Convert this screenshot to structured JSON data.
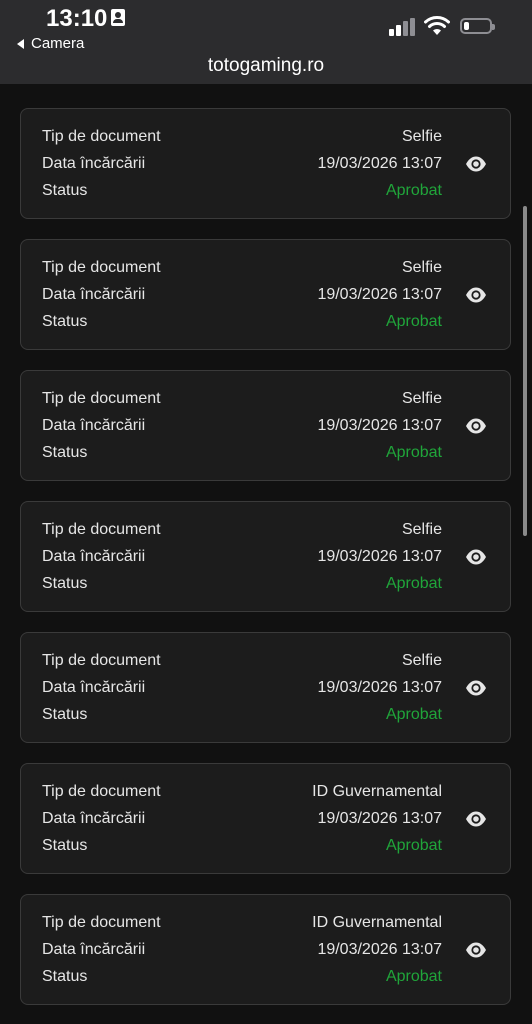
{
  "status_bar": {
    "time": "13:10",
    "back_label": "Camera",
    "url": "totogaming.ro",
    "battery_level": 0.2
  },
  "labels": {
    "type": "Tip de document",
    "date": "Data încărcării",
    "status": "Status"
  },
  "documents": [
    {
      "type": "Selfie",
      "date": "19/03/2026 13:07",
      "status": "Aprobat"
    },
    {
      "type": "Selfie",
      "date": "19/03/2026 13:07",
      "status": "Aprobat"
    },
    {
      "type": "Selfie",
      "date": "19/03/2026 13:07",
      "status": "Aprobat"
    },
    {
      "type": "Selfie",
      "date": "19/03/2026 13:07",
      "status": "Aprobat"
    },
    {
      "type": "Selfie",
      "date": "19/03/2026 13:07",
      "status": "Aprobat"
    },
    {
      "type": "ID Guvernamental",
      "date": "19/03/2026 13:07",
      "status": "Aprobat"
    },
    {
      "type": "ID Guvernamental",
      "date": "19/03/2026 13:07",
      "status": "Aprobat"
    }
  ],
  "colors": {
    "approved": "#20a53a",
    "card_bg": "#1c1c1c",
    "page_bg": "#111111"
  },
  "icons": {
    "view": "eye-icon"
  }
}
